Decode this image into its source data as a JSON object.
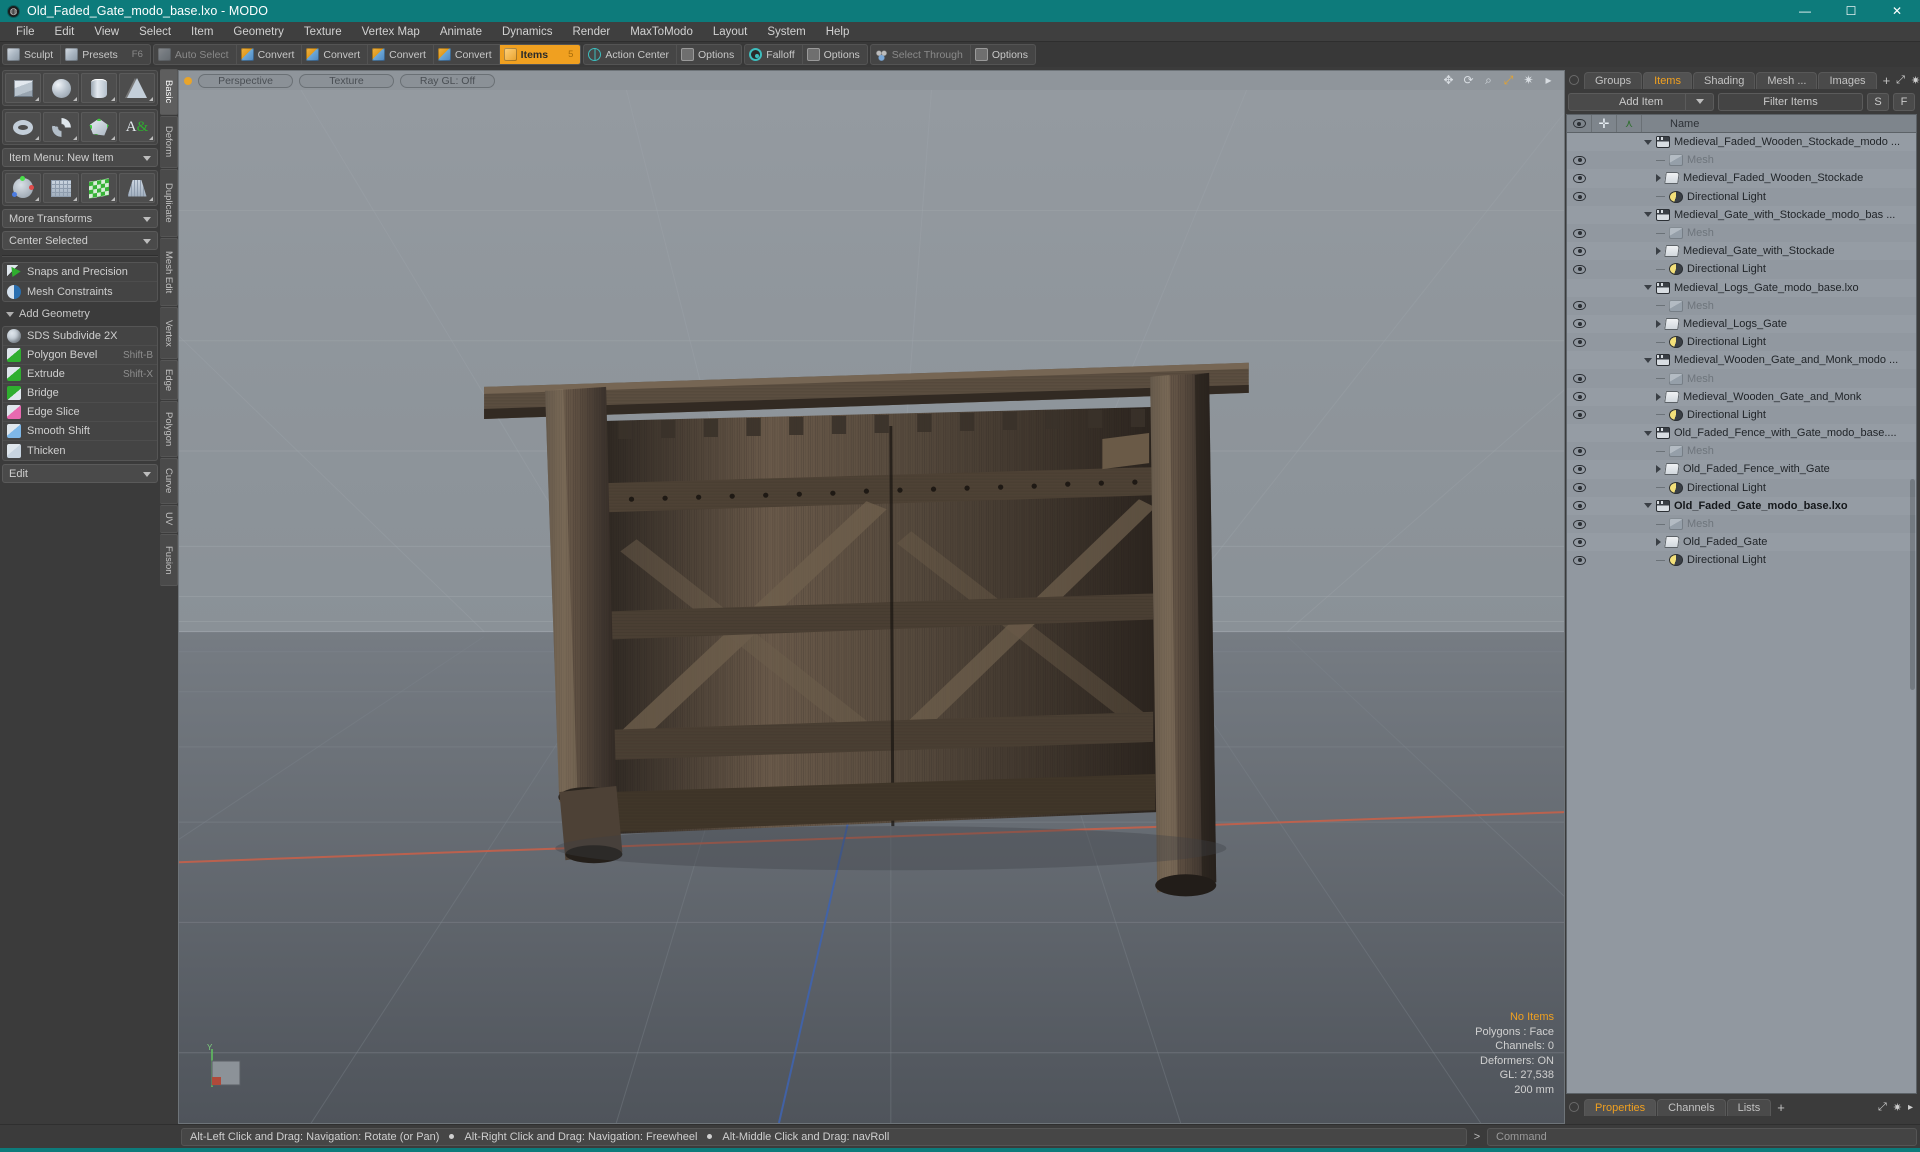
{
  "window": {
    "title": "Old_Faded_Gate_modo_base.lxo - MODO",
    "app_icon": "modo-logo-icon",
    "accent_color": "#0d7b7b",
    "controls": {
      "minimize": "—",
      "maximize": "☐",
      "close": "✕"
    }
  },
  "menubar": {
    "items": [
      "File",
      "Edit",
      "View",
      "Select",
      "Item",
      "Geometry",
      "Texture",
      "Vertex Map",
      "Animate",
      "Dynamics",
      "Render",
      "MaxToModo",
      "Layout",
      "System",
      "Help"
    ]
  },
  "toolbar": {
    "group1": [
      {
        "label": "Sculpt",
        "icon": "sculpt-icon",
        "shortcut": "",
        "state": "normal"
      },
      {
        "label": "Presets",
        "icon": "presets-icon",
        "shortcut": "F6",
        "state": "normal"
      }
    ],
    "group2": [
      {
        "label": "Auto Select",
        "icon": "cube-icon",
        "shortcut": "",
        "state": "dim"
      },
      {
        "label": "Convert",
        "icon": "convert-vertex-icon",
        "shortcut": "",
        "state": "normal"
      },
      {
        "label": "Convert",
        "icon": "convert-edge-icon",
        "shortcut": "",
        "state": "normal"
      },
      {
        "label": "Convert",
        "icon": "convert-polygon-icon",
        "shortcut": "",
        "state": "normal"
      },
      {
        "label": "Convert",
        "icon": "convert-material-icon",
        "shortcut": "",
        "state": "normal"
      },
      {
        "label": "Items",
        "icon": "items-icon",
        "shortcut": "5",
        "state": "active"
      }
    ],
    "group3": [
      {
        "label": "Action Center",
        "icon": "action-center-icon",
        "shortcut": "",
        "state": "normal"
      },
      {
        "label": "Options",
        "icon": "options-icon",
        "shortcut": "",
        "state": "normal"
      }
    ],
    "group4": [
      {
        "label": "Falloff",
        "icon": "falloff-icon",
        "shortcut": "",
        "state": "normal"
      },
      {
        "label": "Options",
        "icon": "options-icon",
        "shortcut": "",
        "state": "normal"
      }
    ],
    "group5": [
      {
        "label": "Select Through",
        "icon": "select-through-icon",
        "shortcut": "",
        "state": "dim"
      },
      {
        "label": "Options",
        "icon": "options-icon",
        "shortcut": "",
        "state": "normal"
      }
    ]
  },
  "left_panel": {
    "primitive_row1": [
      {
        "name": "cube-primitive",
        "glyph": "box"
      },
      {
        "name": "sphere-primitive",
        "glyph": "sphere"
      },
      {
        "name": "cylinder-primitive",
        "glyph": "cylinder"
      },
      {
        "name": "cone-primitive",
        "glyph": "cone"
      }
    ],
    "primitive_row2": [
      {
        "name": "torus-primitive",
        "glyph": "torus"
      },
      {
        "name": "spiral-primitive",
        "glyph": "spiral"
      },
      {
        "name": "polygon-tool",
        "glyph": "poly"
      },
      {
        "name": "text-tool",
        "glyph": "text"
      }
    ],
    "item_menu": {
      "label": "Item Menu: New Item"
    },
    "transform_row": [
      {
        "name": "transform-gizmo-tool",
        "glyph": "axis"
      },
      {
        "name": "bend-tool",
        "glyph": "grid"
      },
      {
        "name": "twist-tool",
        "glyph": "check"
      },
      {
        "name": "taper-tool",
        "glyph": "taper"
      }
    ],
    "more_transforms": {
      "label": "More Transforms"
    },
    "center_selected": {
      "label": "Center Selected"
    },
    "snaps_group": [
      {
        "label": "Snaps and Precision",
        "icon": "snaps-icon",
        "shortcut": ""
      },
      {
        "label": "Mesh Constraints",
        "icon": "mesh-constraints-icon",
        "shortcut": ""
      }
    ],
    "add_geometry_header": "Add Geometry",
    "geometry_items": [
      {
        "label": "SDS Subdivide 2X",
        "icon": "sds-subdivide-icon",
        "shortcut": ""
      },
      {
        "label": "Polygon Bevel",
        "icon": "polygon-bevel-icon",
        "shortcut": "Shift-B"
      },
      {
        "label": "Extrude",
        "icon": "extrude-icon",
        "shortcut": "Shift-X"
      },
      {
        "label": "Bridge",
        "icon": "bridge-icon",
        "shortcut": ""
      },
      {
        "label": "Edge Slice",
        "icon": "edge-slice-icon",
        "shortcut": ""
      },
      {
        "label": "Smooth Shift",
        "icon": "smooth-shift-icon",
        "shortcut": ""
      },
      {
        "label": "Thicken",
        "icon": "thicken-icon",
        "shortcut": ""
      }
    ],
    "edit_dropdown": {
      "label": "Edit"
    },
    "vertical_tabs": [
      {
        "label": "Basic",
        "selected": true
      },
      {
        "label": "Deform",
        "selected": false
      },
      {
        "label": "Duplicate",
        "selected": false
      },
      {
        "label": "Mesh Edit",
        "selected": false
      },
      {
        "label": "Vertex",
        "selected": false
      },
      {
        "label": "Edge",
        "selected": false
      },
      {
        "label": "Polygon",
        "selected": false
      },
      {
        "label": "Curve",
        "selected": false
      },
      {
        "label": "UV",
        "selected": false
      },
      {
        "label": "Fusion",
        "selected": false
      }
    ]
  },
  "viewport": {
    "header": {
      "dot": "viewport-menu-dot",
      "pills": [
        "Perspective",
        "Texture",
        "Ray GL: Off"
      ],
      "icons": [
        "pan-icon",
        "rotate-icon",
        "zoom-icon",
        "fit-icon",
        "gear-icon",
        "chevron-right-icon"
      ]
    },
    "info": {
      "selection": "No Items",
      "polygons": "Polygons : Face",
      "channels": "Channels: 0",
      "deformers": "Deformers: ON",
      "gl": "GL: 27,538",
      "scale": "200 mm"
    },
    "axis_gizmo": {
      "y_label": "Y",
      "x_label": "",
      "z_label": ""
    },
    "model": "old-faded-wooden-gate-3d-model"
  },
  "right_panel": {
    "top_tabs": {
      "tabs": [
        "Groups",
        "Items",
        "Shading",
        "Mesh ...",
        "Images"
      ],
      "selected": "Items",
      "add_label": "+",
      "icons": [
        "expand-icon",
        "gear-icon",
        "chevron-right-icon"
      ]
    },
    "controls": {
      "add_item": "Add Item",
      "filter_placeholder": "Filter Items",
      "btn_s": "S",
      "btn_f": "F"
    },
    "tree_header": {
      "col_visible": "eye-icon",
      "col_lock": "plus-icon",
      "col_transform": "axis-icon",
      "col_name": "Name"
    },
    "tree_rows": [
      {
        "label": "Medieval_Faded_Wooden_Stockade_modo ...",
        "icon": "scene-icon",
        "indent": 0,
        "toggle": "down",
        "eye": false,
        "dim": false,
        "bold": false
      },
      {
        "label": "Mesh",
        "icon": "mesh-icon",
        "indent": 1,
        "toggle": "dash",
        "eye": true,
        "dim": true,
        "bold": false
      },
      {
        "label": "Medieval_Faded_Wooden_Stockade",
        "icon": "folder-icon",
        "indent": 1,
        "toggle": "right",
        "eye": true,
        "dim": false,
        "bold": false
      },
      {
        "label": "Directional Light",
        "icon": "light-icon",
        "indent": 1,
        "toggle": "dash",
        "eye": true,
        "dim": false,
        "bold": false
      },
      {
        "label": "Medieval_Gate_with_Stockade_modo_bas ...",
        "icon": "scene-icon",
        "indent": 0,
        "toggle": "down",
        "eye": false,
        "dim": false,
        "bold": false
      },
      {
        "label": "Mesh",
        "icon": "mesh-icon",
        "indent": 1,
        "toggle": "dash",
        "eye": true,
        "dim": true,
        "bold": false
      },
      {
        "label": "Medieval_Gate_with_Stockade",
        "icon": "folder-icon",
        "indent": 1,
        "toggle": "right",
        "eye": true,
        "dim": false,
        "bold": false
      },
      {
        "label": "Directional Light",
        "icon": "light-icon",
        "indent": 1,
        "toggle": "dash",
        "eye": true,
        "dim": false,
        "bold": false
      },
      {
        "label": "Medieval_Logs_Gate_modo_base.lxo",
        "icon": "scene-icon",
        "indent": 0,
        "toggle": "down",
        "eye": false,
        "dim": false,
        "bold": false
      },
      {
        "label": "Mesh",
        "icon": "mesh-icon",
        "indent": 1,
        "toggle": "dash",
        "eye": true,
        "dim": true,
        "bold": false
      },
      {
        "label": "Medieval_Logs_Gate",
        "icon": "folder-icon",
        "indent": 1,
        "toggle": "right",
        "eye": true,
        "dim": false,
        "bold": false
      },
      {
        "label": "Directional Light",
        "icon": "light-icon",
        "indent": 1,
        "toggle": "dash",
        "eye": true,
        "dim": false,
        "bold": false
      },
      {
        "label": "Medieval_Wooden_Gate_and_Monk_modo ...",
        "icon": "scene-icon",
        "indent": 0,
        "toggle": "down",
        "eye": false,
        "dim": false,
        "bold": false
      },
      {
        "label": "Mesh",
        "icon": "mesh-icon",
        "indent": 1,
        "toggle": "dash",
        "eye": true,
        "dim": true,
        "bold": false
      },
      {
        "label": "Medieval_Wooden_Gate_and_Monk",
        "icon": "folder-icon",
        "indent": 1,
        "toggle": "right",
        "eye": true,
        "dim": false,
        "bold": false
      },
      {
        "label": "Directional Light",
        "icon": "light-icon",
        "indent": 1,
        "toggle": "dash",
        "eye": true,
        "dim": false,
        "bold": false
      },
      {
        "label": "Old_Faded_Fence_with_Gate_modo_base....",
        "icon": "scene-icon",
        "indent": 0,
        "toggle": "down",
        "eye": false,
        "dim": false,
        "bold": false
      },
      {
        "label": "Mesh",
        "icon": "mesh-icon",
        "indent": 1,
        "toggle": "dash",
        "eye": true,
        "dim": true,
        "bold": false
      },
      {
        "label": "Old_Faded_Fence_with_Gate",
        "icon": "folder-icon",
        "indent": 1,
        "toggle": "right",
        "eye": true,
        "dim": false,
        "bold": false
      },
      {
        "label": "Directional Light",
        "icon": "light-icon",
        "indent": 1,
        "toggle": "dash",
        "eye": true,
        "dim": false,
        "bold": false
      },
      {
        "label": "Old_Faded_Gate_modo_base.lxo",
        "icon": "scene-icon",
        "indent": 0,
        "toggle": "down",
        "eye": true,
        "dim": false,
        "bold": true
      },
      {
        "label": "Mesh",
        "icon": "mesh-icon",
        "indent": 1,
        "toggle": "dash",
        "eye": true,
        "dim": true,
        "bold": false
      },
      {
        "label": "Old_Faded_Gate",
        "icon": "folder-icon",
        "indent": 1,
        "toggle": "right",
        "eye": true,
        "dim": false,
        "bold": false
      },
      {
        "label": "Directional Light",
        "icon": "light-icon",
        "indent": 1,
        "toggle": "dash",
        "eye": true,
        "dim": false,
        "bold": false
      }
    ],
    "bottom_tabs": {
      "tabs": [
        "Properties",
        "Channels",
        "Lists"
      ],
      "selected": "Properties",
      "add_label": "+",
      "icons": [
        "expand-icon",
        "gear-icon",
        "chevron-right-icon"
      ]
    }
  },
  "statusbar": {
    "hints": [
      "Alt-Left Click and Drag: Navigation: Rotate (or Pan)",
      "Alt-Right Click and Drag: Navigation: Freewheel",
      "Alt-Middle Click and Drag: navRoll"
    ],
    "command_prompt": ">",
    "command_placeholder": "Command"
  }
}
